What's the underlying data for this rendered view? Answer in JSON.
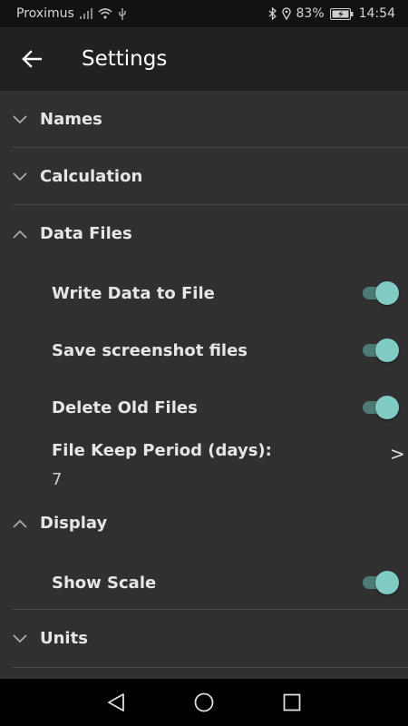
{
  "status_bar": {
    "carrier": "Proximus",
    "battery_percent": "83%",
    "time": "14:54"
  },
  "app_bar": {
    "title": "Settings"
  },
  "sections": {
    "names": {
      "label": "Names",
      "expanded": false
    },
    "calculation": {
      "label": "Calculation",
      "expanded": false
    },
    "data_files": {
      "label": "Data Files",
      "expanded": true,
      "items": {
        "write_data": {
          "label": "Write Data to File",
          "enabled": true
        },
        "save_screenshot": {
          "label": "Save screenshot files",
          "enabled": true
        },
        "delete_old": {
          "label": "Delete Old Files",
          "enabled": true
        },
        "keep_period": {
          "label": "File Keep Period (days):",
          "value": "7",
          "arrow": ">"
        }
      }
    },
    "display": {
      "label": "Display",
      "expanded": true,
      "items": {
        "show_scale": {
          "label": "Show Scale",
          "enabled": true
        }
      }
    },
    "units": {
      "label": "Units",
      "expanded": false
    }
  },
  "colors": {
    "accent": "#80cbc4",
    "background": "#303030",
    "app_bar": "#212121"
  }
}
